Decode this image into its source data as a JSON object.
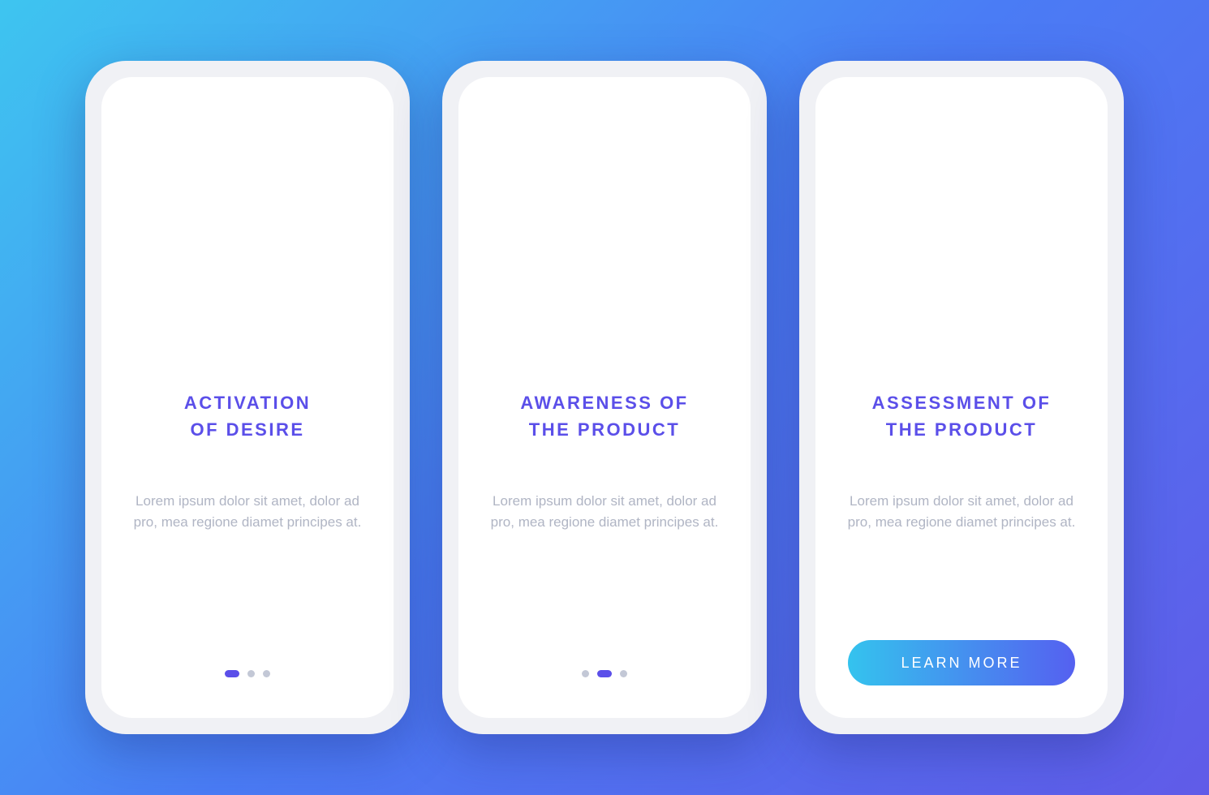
{
  "screens": [
    {
      "title": "ACTIVATION\nOF DESIRE",
      "description": "Lorem ipsum dolor sit amet, dolor ad pro, mea regione diamet principes at.",
      "illustration": "desire-illustration",
      "footer": {
        "type": "dots",
        "active_index": 0
      }
    },
    {
      "title": "AWARENESS OF\nTHE PRODUCT",
      "description": "Lorem ipsum dolor sit amet, dolor ad pro, mea regione diamet principes at.",
      "illustration": "awareness-illustration",
      "footer": {
        "type": "dots",
        "active_index": 1
      }
    },
    {
      "title": "ASSESSMENT OF\nTHE PRODUCT",
      "description": "Lorem ipsum dolor sit amet, dolor ad pro, mea regione diamet principes at.",
      "illustration": "assessment-illustration",
      "footer": {
        "type": "button",
        "label": "LEARN MORE"
      }
    }
  ],
  "colors": {
    "accent": "#5b4fe9",
    "gradient_start": "#34c3ee",
    "gradient_end": "#5560f0",
    "muted_text": "#b0b5c4"
  }
}
